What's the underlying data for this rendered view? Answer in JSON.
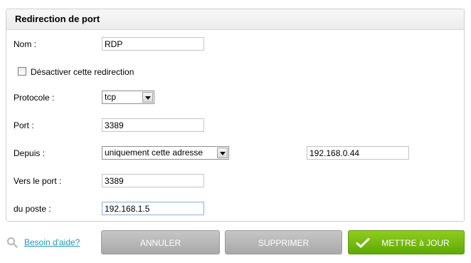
{
  "panel": {
    "title": "Redirection de port"
  },
  "form": {
    "name_label": "Nom :",
    "name_value": "RDP",
    "disable_label": "Désactiver cette redirection",
    "protocol_label": "Protocole :",
    "protocol_value": "tcp",
    "port_label": "Port :",
    "port_value": "3389",
    "from_label": "Depuis :",
    "from_select_value": "uniquement cette adresse",
    "from_address_value": "192.168.0.44",
    "to_port_label": "Vers le port :",
    "to_port_value": "3389",
    "host_label": "du poste :",
    "host_value": "192.168.1.5"
  },
  "footer": {
    "help_link": "Besoin d'aide?",
    "cancel_label": "ANNULER",
    "delete_label": "SUPPRIMER",
    "update_label": "METTRE à JOUR"
  },
  "icons": {
    "help": "search-icon",
    "update": "check-icon"
  },
  "colors": {
    "accent_green": "#6fba12",
    "button_grey": "#b3b3b3",
    "link": "#2a90b8"
  }
}
